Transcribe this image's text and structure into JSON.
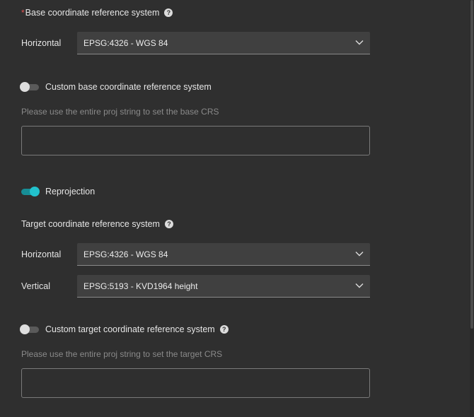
{
  "base_crs": {
    "required_marker": "*",
    "title": "Base coordinate reference system",
    "help_icon": "question-circle-icon",
    "horizontal_label": "Horizontal",
    "horizontal_value": "EPSG:4326 - WGS 84"
  },
  "custom_base": {
    "toggle_state": "off",
    "label": "Custom base coordinate reference system",
    "hint": "Please use the entire proj string to set the base CRS",
    "value": ""
  },
  "reprojection": {
    "toggle_state": "on",
    "label": "Reprojection"
  },
  "target_crs": {
    "title": "Target coordinate reference system",
    "help_icon": "question-circle-icon",
    "horizontal_label": "Horizontal",
    "horizontal_value": "EPSG:4326 - WGS 84",
    "vertical_label": "Vertical",
    "vertical_value": "EPSG:5193 - KVD1964 height"
  },
  "custom_target": {
    "toggle_state": "off",
    "label": "Custom target coordinate reference system",
    "help_icon": "question-circle-icon",
    "hint": "Please use the entire proj string to set the target CRS",
    "value": ""
  },
  "colors": {
    "background": "#2f2f2f",
    "select_bg": "#404040",
    "accent": "#22c1cc",
    "required": "#e05454",
    "hint_text": "#8a8a8a"
  },
  "icons": {
    "dropdown": "chevron-down-icon",
    "help": "question-circle-icon"
  }
}
